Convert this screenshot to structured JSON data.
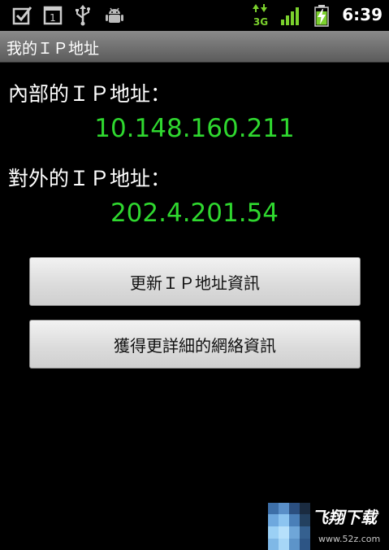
{
  "status_bar": {
    "time": "6:39",
    "network": "3G",
    "icons": [
      "checkbox-icon",
      "calendar-icon",
      "usb-icon",
      "android-debug-icon",
      "data-3g-icon",
      "signal-icon",
      "battery-charging-icon"
    ],
    "calendar_day": "1"
  },
  "app": {
    "title": "我的ＩＰ地址"
  },
  "internal": {
    "label": "內部的ＩＰ地址：",
    "ip": "10.148.160.211"
  },
  "external": {
    "label": "對外的ＩＰ地址：",
    "ip": "202.4.201.54"
  },
  "buttons": {
    "refresh": "更新ＩＰ地址資訊",
    "details": "獲得更詳細的網絡資訊"
  },
  "watermark": {
    "title": "飞翔下载",
    "url": "www.52z.com"
  },
  "colors": {
    "ip_text": "#2fd82f",
    "background": "#000000"
  }
}
